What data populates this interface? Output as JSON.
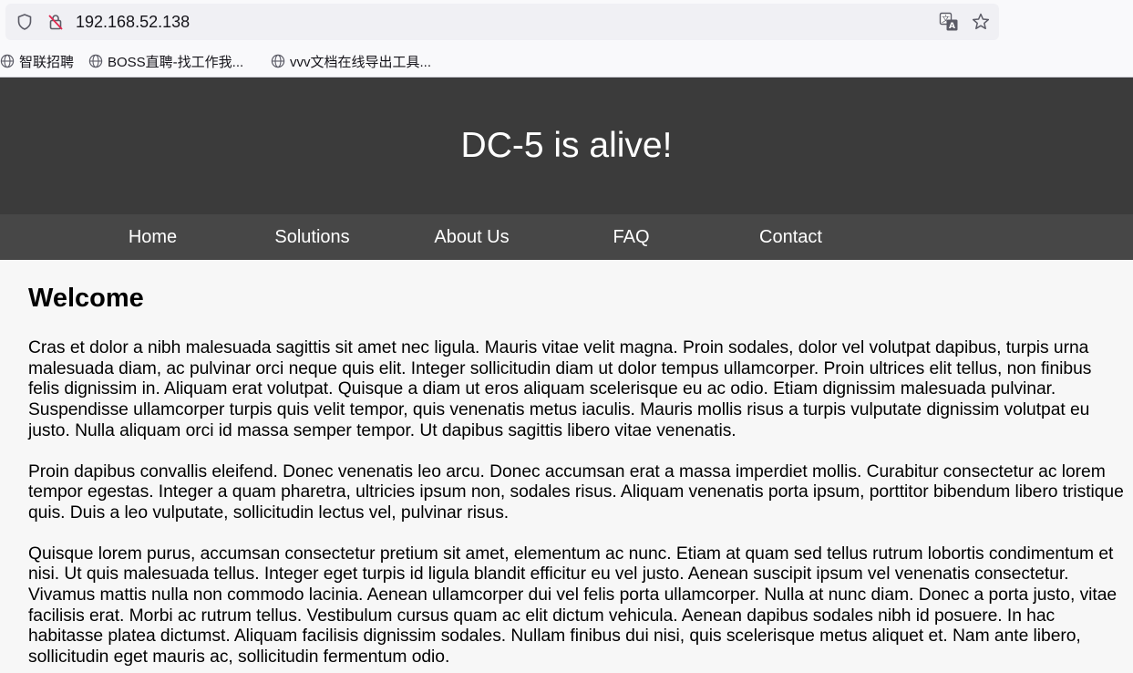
{
  "browser": {
    "url": "192.168.52.138",
    "icons": {
      "tracking": "shield-icon",
      "insecure": "insecure-lock-icon",
      "translate": "translate-icon",
      "bookmark": "star-icon"
    },
    "bookmarks": [
      {
        "label": "智联招聘",
        "icon": "globe-icon"
      },
      {
        "label": "BOSS直聘-找工作我...",
        "icon": "globe-icon"
      },
      {
        "label": "vvv文档在线导出工具...",
        "icon": "globe-icon"
      }
    ]
  },
  "page": {
    "title": "DC-5 is alive!",
    "nav": [
      {
        "label": "Home"
      },
      {
        "label": "Solutions"
      },
      {
        "label": "About Us"
      },
      {
        "label": "FAQ"
      },
      {
        "label": "Contact"
      }
    ],
    "heading": "Welcome",
    "paragraphs": [
      "Cras et dolor a nibh malesuada sagittis sit amet nec ligula. Mauris vitae velit magna. Proin sodales, dolor vel volutpat dapibus, turpis urna malesuada diam, ac pulvinar orci neque quis elit. Integer sollicitudin diam ut dolor tempus ullamcorper. Proin ultrices elit tellus, non finibus felis dignissim in. Aliquam erat volutpat. Quisque a diam ut eros aliquam scelerisque eu ac odio. Etiam dignissim malesuada pulvinar. Suspendisse ullamcorper turpis quis velit tempor, quis venenatis metus iaculis. Mauris mollis risus a turpis vulputate dignissim volutpat eu justo. Nulla aliquam orci id massa semper tempor. Ut dapibus sagittis libero vitae venenatis.",
      "Proin dapibus convallis eleifend. Donec venenatis leo arcu. Donec accumsan erat a massa imperdiet mollis. Curabitur consectetur ac lorem tempor egestas. Integer a quam pharetra, ultricies ipsum non, sodales risus. Aliquam venenatis porta ipsum, porttitor bibendum libero tristique quis. Duis a leo vulputate, sollicitudin lectus vel, pulvinar risus.",
      "Quisque lorem purus, accumsan consectetur pretium sit amet, elementum ac nunc. Etiam at quam sed tellus rutrum lobortis condimentum et nisi. Ut quis malesuada tellus. Integer eget turpis id ligula blandit efficitur eu vel justo. Aenean suscipit ipsum vel venenatis consectetur. Vivamus mattis nulla non commodo lacinia. Aenean ullamcorper dui vel felis porta ullamcorper. Nulla at nunc diam. Donec a porta justo, vitae facilisis erat. Morbi ac rutrum tellus. Vestibulum cursus quam ac elit dictum vehicula. Aenean dapibus sodales nibh id posuere. In hac habitasse platea dictumst. Aliquam facilisis dignissim sodales. Nullam finibus dui nisi, quis scelerisque metus aliquet et. Nam ante libero, sollicitudin eget mauris ac, sollicitudin fermentum odio."
    ],
    "colors": {
      "header_bg": "#3b3b3b",
      "nav_bg": "#474747",
      "body_bg": "#f7f7f7",
      "header_text": "#ffffff"
    }
  }
}
